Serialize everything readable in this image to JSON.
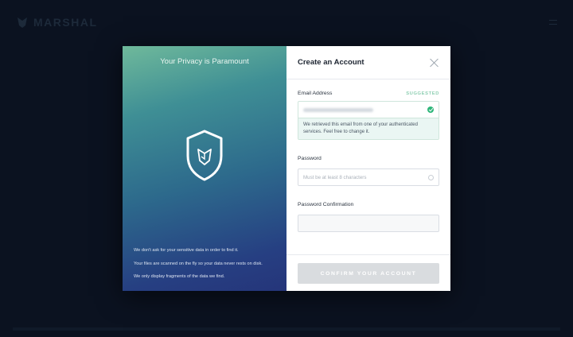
{
  "app": {
    "logo_text": "MARSHAL"
  },
  "left_panel": {
    "title": "Your Privacy is Paramount",
    "notes": [
      "We don't ask for your sensitive data in order to find it.",
      "Your files are scanned on the fly so your data never rests on disk.",
      "We only display fragments of the data we find."
    ],
    "icon": "shield-fox-icon"
  },
  "modal": {
    "title": "Create an Account"
  },
  "form": {
    "email": {
      "label": "Email Address",
      "badge": "SUGGESTED",
      "note": "We retrieved this email from one of your authenticated services. Feel free to change it."
    },
    "password": {
      "label": "Password",
      "placeholder": "Must be at least 8 characters"
    },
    "password_confirmation": {
      "label": "Password Confirmation"
    },
    "confirm_button": "CONFIRM YOUR ACCOUNT"
  },
  "colors": {
    "accent_green": "#2fb67a",
    "suggested": "#8fcfb3"
  }
}
